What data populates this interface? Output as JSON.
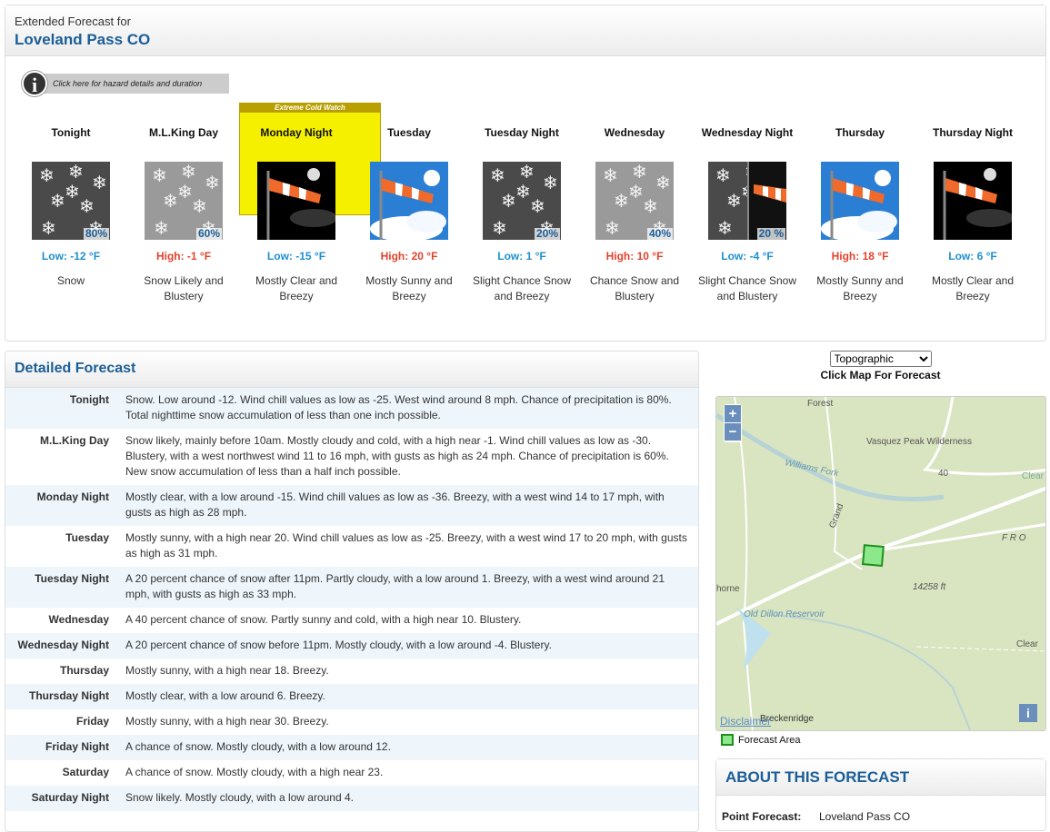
{
  "header": {
    "subtitle": "Extended Forecast for",
    "location": "Loveland Pass CO"
  },
  "hazard": {
    "label": "Click here for hazard details and duration",
    "icon": "info-icon"
  },
  "tiles": [
    {
      "period": "Tonight",
      "icon": "snow",
      "pop": "80%",
      "temp": "Low: -12 °F",
      "kind": "lo",
      "desc": "Snow"
    },
    {
      "period": "M.L.King Day",
      "icon": "snow-light",
      "pop": "60%",
      "temp": "High: -1 °F",
      "kind": "hi",
      "desc": "Snow Likely and Blustery"
    },
    {
      "period": "Monday Night",
      "icon": "wind-night",
      "pop": "",
      "temp": "Low: -15 °F",
      "kind": "lo",
      "desc": "Mostly Clear and Breezy",
      "hazard": "Extreme Cold Watch"
    },
    {
      "period": "Tuesday",
      "icon": "wind-day",
      "pop": "",
      "temp": "High: 20 °F",
      "kind": "hi",
      "desc": "Mostly Sunny and Breezy"
    },
    {
      "period": "Tuesday Night",
      "icon": "snow",
      "pop": "20%",
      "temp": "Low: 1 °F",
      "kind": "lo",
      "desc": "Slight Chance Snow and Breezy"
    },
    {
      "period": "Wednesday",
      "icon": "snow-light",
      "pop": "40%",
      "temp": "High: 10 °F",
      "kind": "hi",
      "desc": "Chance Snow and Blustery"
    },
    {
      "period": "Wednesday Night",
      "icon": "snow-wind-night",
      "pop": "20 %",
      "temp": "Low: -4 °F",
      "kind": "lo",
      "desc": "Slight Chance Snow and Blustery"
    },
    {
      "period": "Thursday",
      "icon": "wind-day",
      "pop": "",
      "temp": "High: 18 °F",
      "kind": "hi",
      "desc": "Mostly Sunny and Breezy"
    },
    {
      "period": "Thursday Night",
      "icon": "wind-night",
      "pop": "",
      "temp": "Low: 6 °F",
      "kind": "lo",
      "desc": "Mostly Clear and Breezy"
    }
  ],
  "detailed": {
    "title": "Detailed Forecast",
    "rows": [
      {
        "k": "Tonight",
        "v": "Snow. Low around -12. Wind chill values as low as -25. West wind around 8 mph. Chance of precipitation is 80%. Total nighttime snow accumulation of less than one inch possible."
      },
      {
        "k": "M.L.King Day",
        "v": "Snow likely, mainly before 10am. Mostly cloudy and cold, with a high near -1. Wind chill values as low as -30. Blustery, with a west northwest wind 11 to 16 mph, with gusts as high as 24 mph. Chance of precipitation is 60%. New snow accumulation of less than a half inch possible."
      },
      {
        "k": "Monday Night",
        "v": "Mostly clear, with a low around -15. Wind chill values as low as -36. Breezy, with a west wind 14 to 17 mph, with gusts as high as 28 mph."
      },
      {
        "k": "Tuesday",
        "v": "Mostly sunny, with a high near 20. Wind chill values as low as -25. Breezy, with a west wind 17 to 20 mph, with gusts as high as 31 mph."
      },
      {
        "k": "Tuesday Night",
        "v": "A 20 percent chance of snow after 11pm. Partly cloudy, with a low around 1. Breezy, with a west wind around 21 mph, with gusts as high as 33 mph."
      },
      {
        "k": "Wednesday",
        "v": "A 40 percent chance of snow. Partly sunny and cold, with a high near 10. Blustery."
      },
      {
        "k": "Wednesday Night",
        "v": "A 20 percent chance of snow before 11pm. Mostly cloudy, with a low around -4. Blustery."
      },
      {
        "k": "Thursday",
        "v": "Mostly sunny, with a high near 18. Breezy."
      },
      {
        "k": "Thursday Night",
        "v": "Mostly clear, with a low around 6. Breezy."
      },
      {
        "k": "Friday",
        "v": "Mostly sunny, with a high near 30. Breezy."
      },
      {
        "k": "Friday Night",
        "v": "A chance of snow. Mostly cloudy, with a low around 12."
      },
      {
        "k": "Saturday",
        "v": "A chance of snow. Mostly cloudy, with a high near 23."
      },
      {
        "k": "Saturday Night",
        "v": "Snow likely. Mostly cloudy, with a low around 4."
      }
    ]
  },
  "map": {
    "layer": "Topographic",
    "hint": "Click Map For Forecast",
    "zoom_in": "+",
    "zoom_out": "−",
    "disclaimer": "Disclaimer",
    "info": "i",
    "labels": [
      "Forest",
      "Vasquez Peak Wilderness",
      "Williams Fork",
      "40",
      "Clear",
      "Grand",
      "F R O",
      "14258 ft",
      "horne",
      "Old Dillon Reservoir",
      "Clear",
      "Breckenridge"
    ],
    "legend": "Forecast Area"
  },
  "about": {
    "title": "ABOUT THIS FORECAST",
    "point_label": "Point Forecast:",
    "point_value": "Loveland Pass CO"
  },
  "colors": {
    "accent": "#1b5e97",
    "low": "#1e8fd0",
    "high": "#e2422c",
    "hazard": "#f5f000"
  }
}
